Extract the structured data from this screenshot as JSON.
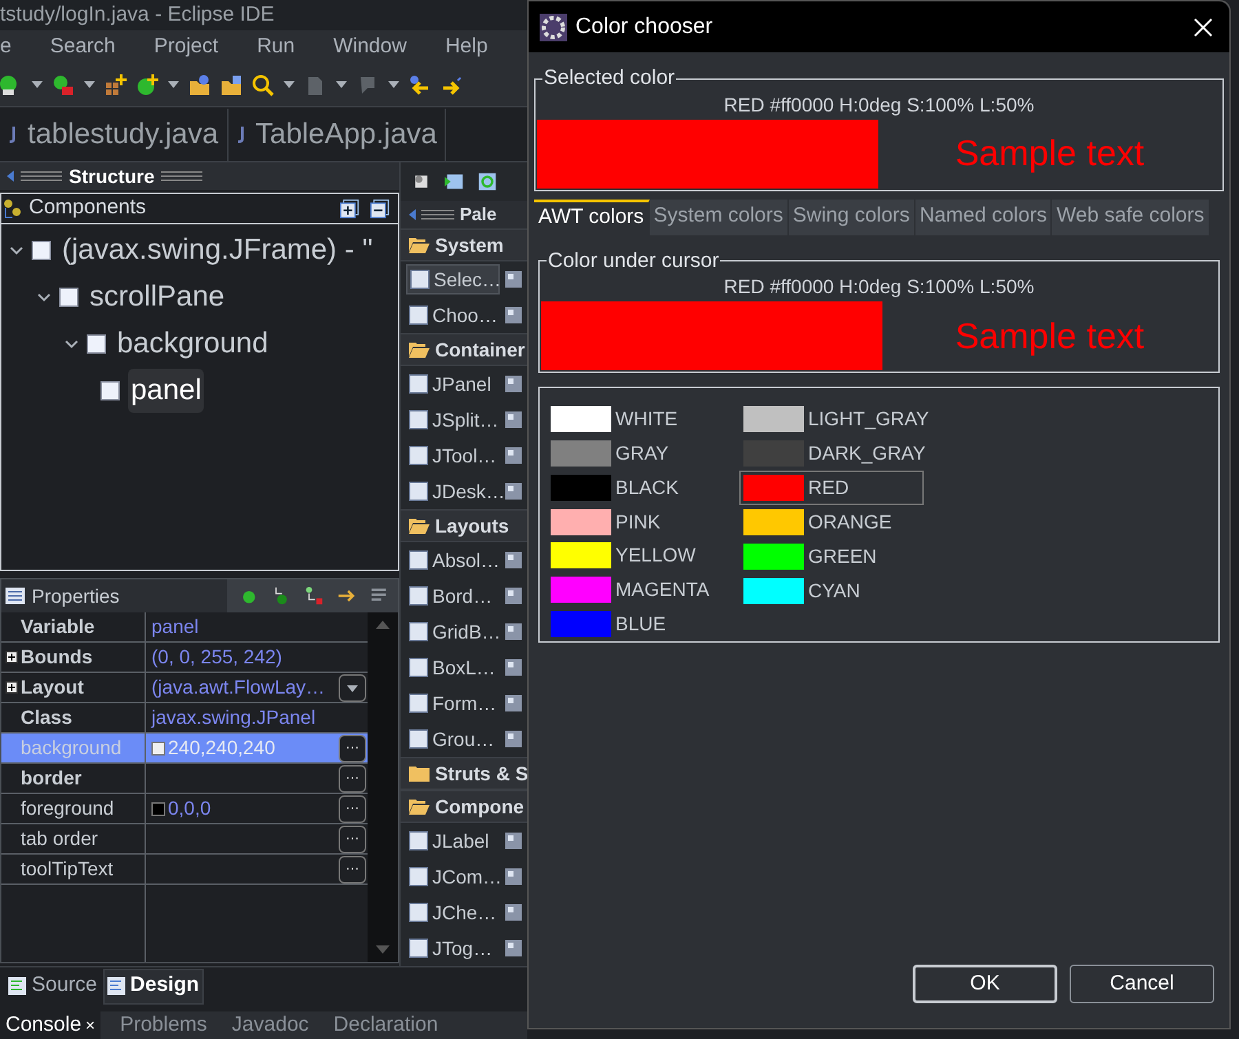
{
  "window": {
    "title": "tstudy/logIn.java - Eclipse IDE"
  },
  "menu": [
    "e",
    "Search",
    "Project",
    "Run",
    "Window",
    "Help"
  ],
  "editor_tabs": [
    "tablestudy.java",
    "TableApp.java"
  ],
  "structure": {
    "title": "Structure"
  },
  "components": {
    "title": "Components",
    "tree": [
      {
        "label": "(javax.swing.JFrame) - \"",
        "expanded": true,
        "selected": false,
        "children": [
          {
            "label": "scrollPane",
            "expanded": true,
            "selected": false,
            "children": [
              {
                "label": "background",
                "expanded": true,
                "selected": false,
                "children": [
                  {
                    "label": "panel",
                    "selected": true
                  }
                ]
              }
            ]
          }
        ]
      }
    ]
  },
  "properties": {
    "title": "Properties",
    "rows": [
      {
        "name": "Variable",
        "value": "panel",
        "bold": true,
        "expandable": false,
        "selected": false
      },
      {
        "name": "Bounds",
        "value": "(0, 0, 255, 242)",
        "bold": true,
        "expandable": true,
        "selected": false
      },
      {
        "name": "Layout",
        "value": "(java.awt.FlowLay…",
        "bold": true,
        "expandable": true,
        "selected": false,
        "editor": {
          "kind": "dropdown"
        }
      },
      {
        "name": "Class",
        "value": "javax.swing.JPanel",
        "bold": true,
        "expandable": false,
        "selected": false
      },
      {
        "name": "background",
        "value": "240,240,240",
        "color": "#f0f0f0",
        "bold": false,
        "expandable": false,
        "selected": true,
        "editor": {
          "kind": "ellipsis",
          "label": "···"
        }
      },
      {
        "name": "border",
        "bold": true,
        "expandable": false,
        "selected": false,
        "editor": {
          "kind": "ellipsis",
          "label": "···"
        }
      },
      {
        "name": "foreground",
        "value": "0,0,0",
        "color": "#000000",
        "bold": false,
        "expandable": false,
        "selected": false,
        "editor": {
          "kind": "ellipsis",
          "label": "···"
        }
      },
      {
        "name": "tab order",
        "bold": false,
        "expandable": false,
        "selected": false,
        "editor": {
          "kind": "ellipsis",
          "label": "···"
        }
      },
      {
        "name": "toolTipText",
        "bold": false,
        "expandable": false,
        "selected": false,
        "editor": {
          "kind": "ellipsis",
          "label": "···"
        }
      }
    ]
  },
  "palette": {
    "title": "Pale",
    "sections": [
      {
        "title": "System",
        "expanded": true,
        "items": [
          {
            "label": "Selec…",
            "selected": true
          },
          {
            "label": "Choo…",
            "selected": false
          }
        ]
      },
      {
        "title": "Container",
        "expanded": true,
        "items": [
          {
            "label": "JPanel",
            "selected": false
          },
          {
            "label": "JSplit…",
            "selected": false
          },
          {
            "label": "JTool…",
            "selected": false
          },
          {
            "label": "JDesk…",
            "selected": false
          }
        ]
      },
      {
        "title": "Layouts",
        "expanded": true,
        "items": [
          {
            "label": "Absol…",
            "selected": false
          },
          {
            "label": "Bord…",
            "selected": false
          },
          {
            "label": "GridB…",
            "selected": false
          },
          {
            "label": "BoxL…",
            "selected": false
          },
          {
            "label": "Form…",
            "selected": false
          },
          {
            "label": "Grou…",
            "selected": false
          }
        ]
      },
      {
        "title": "Struts & S",
        "expanded": false
      },
      {
        "title": "Compone",
        "expanded": true,
        "items": [
          {
            "label": "JLabel",
            "selected": false
          },
          {
            "label": "JCom…",
            "selected": false
          },
          {
            "label": "JChe…",
            "selected": false
          },
          {
            "label": "JTog…",
            "selected": false
          }
        ]
      }
    ]
  },
  "design_tabs": [
    {
      "label": "Source",
      "selected": false
    },
    {
      "label": "Design",
      "selected": true
    }
  ],
  "bottom_tabs": [
    {
      "label": "Console",
      "selected": true,
      "close": "×"
    },
    {
      "label": "Problems",
      "selected": false
    },
    {
      "label": "Javadoc",
      "selected": false
    },
    {
      "label": "Declaration",
      "selected": false
    }
  ],
  "dialog": {
    "title": "Color chooser",
    "selected_color": {
      "legend": "Selected color",
      "info": "RED #ff0000 H:0deg S:100% L:50%",
      "color": "#ff0000",
      "sample": "Sample text"
    },
    "tabs": [
      {
        "label": "AWT colors",
        "selected": true
      },
      {
        "label": "System colors",
        "selected": false
      },
      {
        "label": "Swing colors",
        "selected": false
      },
      {
        "label": "Named colors",
        "selected": false
      },
      {
        "label": "Web safe colors",
        "selected": false
      }
    ],
    "cursor_color": {
      "legend": "Color under cursor",
      "info": "RED #ff0000 H:0deg S:100% L:50%",
      "color": "#ff0000",
      "sample": "Sample text"
    },
    "swatches": {
      "columns": [
        [
          {
            "name": "WHITE",
            "color": "#ffffff",
            "selected": false
          },
          {
            "name": "GRAY",
            "color": "#808080",
            "selected": false
          },
          {
            "name": "BLACK",
            "color": "#000000",
            "selected": false
          },
          {
            "name": "PINK",
            "color": "#ffafaf",
            "selected": false
          },
          {
            "name": "YELLOW",
            "color": "#ffff00",
            "selected": false
          },
          {
            "name": "MAGENTA",
            "color": "#ff00ff",
            "selected": false
          },
          {
            "name": "BLUE",
            "color": "#0000ff",
            "selected": false
          }
        ],
        [
          {
            "name": "LIGHT_GRAY",
            "color": "#c0c0c0",
            "selected": false
          },
          {
            "name": "DARK_GRAY",
            "color": "#404040",
            "selected": false
          },
          {
            "name": "RED",
            "color": "#ff0000",
            "selected": true
          },
          {
            "name": "ORANGE",
            "color": "#ffc800",
            "selected": false
          },
          {
            "name": "GREEN",
            "color": "#00ff00",
            "selected": false
          },
          {
            "name": "CYAN",
            "color": "#00ffff",
            "selected": false
          }
        ]
      ]
    },
    "buttons": [
      {
        "label": "OK",
        "focused": true
      },
      {
        "label": "Cancel",
        "focused": false
      }
    ]
  }
}
